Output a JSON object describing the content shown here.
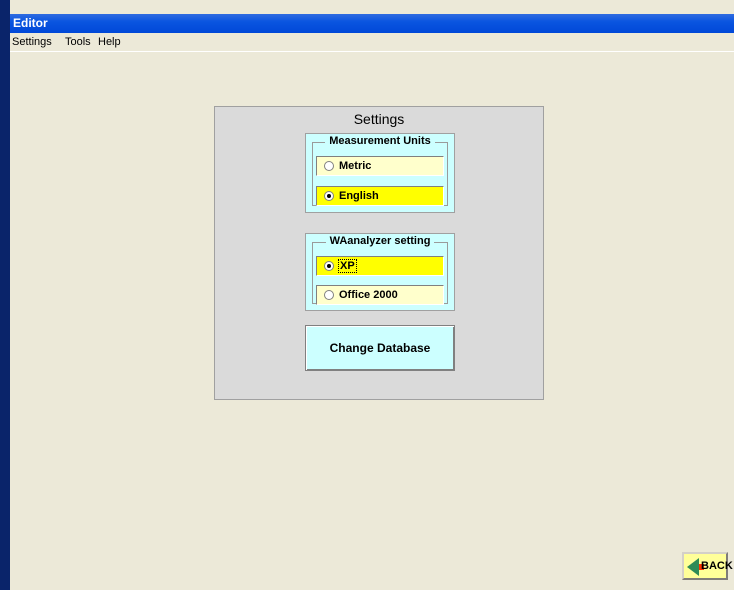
{
  "window": {
    "title": "Editor"
  },
  "menu": {
    "items": [
      "Settings",
      "Tools",
      "Help"
    ]
  },
  "panel": {
    "title": "Settings",
    "measurement_units": {
      "label": "Measurement Units",
      "options": [
        {
          "label": "Metric",
          "selected": false
        },
        {
          "label": "English",
          "selected": true
        }
      ]
    },
    "analyzer": {
      "label": "WAanalyzer setting",
      "options": [
        {
          "label": "XP",
          "selected": true
        },
        {
          "label": "Office 2000",
          "selected": false
        }
      ]
    },
    "change_db_label": "Change Database"
  },
  "back_button": {
    "label": "BACK",
    "icon": "back-arrow-icon"
  },
  "colors": {
    "titlebar": "#0A55E0",
    "group_bg": "#CCFFFF",
    "selected_bg": "#FFFF00",
    "unselected_bg": "#FFFFCC",
    "background": "#ECE9D8"
  }
}
